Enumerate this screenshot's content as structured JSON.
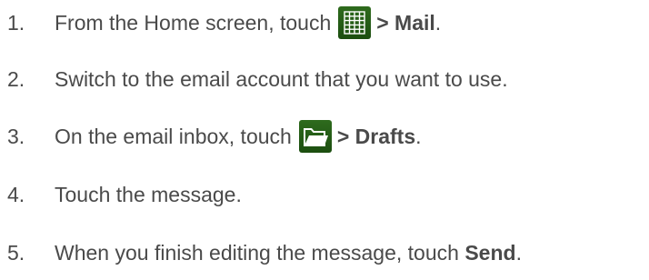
{
  "steps": [
    {
      "number": "1.",
      "text_before": "From the Home screen, touch",
      "icon": "apps-grid-icon",
      "bold": "> Mail",
      "text_after": "."
    },
    {
      "number": "2.",
      "text": "Switch to the email account that you want to use."
    },
    {
      "number": "3.",
      "text_before": "On the email inbox, touch",
      "icon": "folder-icon",
      "bold": "> Drafts",
      "text_after": "."
    },
    {
      "number": "4.",
      "text": "Touch the message."
    },
    {
      "number": "5.",
      "text_before": "When you finish editing the message, touch",
      "bold": "Send",
      "text_after": "."
    }
  ],
  "colors": {
    "text": "#4a4a4a",
    "icon_background": "#1f5a12"
  }
}
